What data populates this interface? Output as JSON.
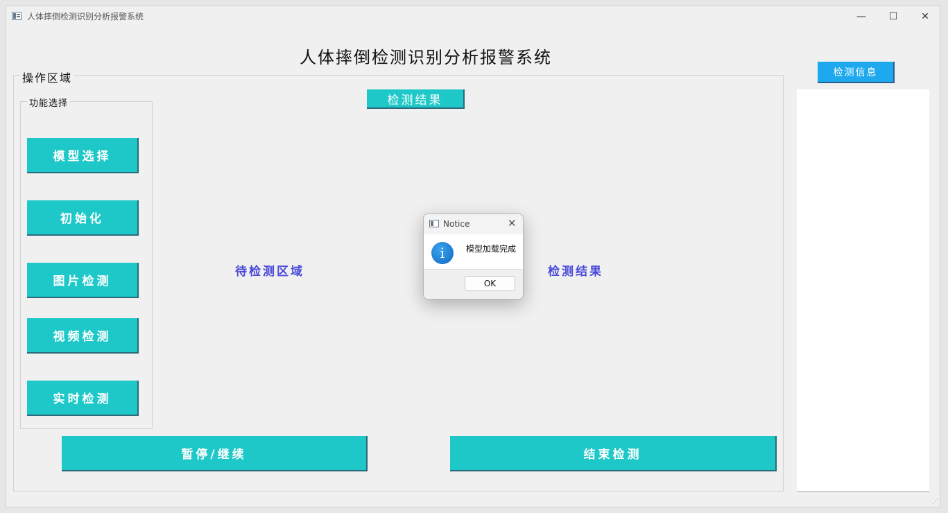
{
  "window": {
    "title": "人体摔倒检测识别分析报警系统",
    "controls": {
      "minimize": "—",
      "maximize": "☐",
      "close": "✕"
    }
  },
  "main_title": "人体摔倒检测识别分析报警系统",
  "operation_area": {
    "legend": "操作区域"
  },
  "function_select": {
    "legend": "功能选择",
    "buttons": [
      "模型选择",
      "初始化",
      "图片检测",
      "视频检测",
      "实时检测"
    ]
  },
  "detection_result_tag": "检测结果",
  "pending_area_label": "待检测区域",
  "result_area_label": "检测结果",
  "bottom_buttons": {
    "pause_resume": "暂停/继续",
    "end_detection": "结束检测"
  },
  "info_panel": {
    "button_label": "检测信息"
  },
  "dialog": {
    "title": "Notice",
    "close": "✕",
    "icon": "i",
    "message": "模型加载完成",
    "ok_label": "OK"
  },
  "colors": {
    "button_teal": "#1fc8c8",
    "button_blue": "#1ea8ee",
    "label_blue": "#4a4adb",
    "background": "#f0f0f0"
  }
}
